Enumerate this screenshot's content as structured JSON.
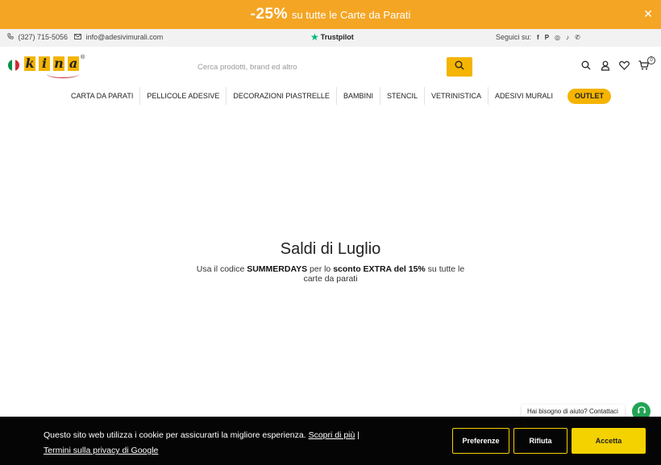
{
  "promo": {
    "percent": "-25%",
    "text": "su tutte le Carte da Parati",
    "close": "✕"
  },
  "infobar": {
    "phone": "(327) 715-5056",
    "email": "info@adesivimurali.com",
    "trustpilot": "Trustpilot",
    "follow_label": "Seguici su:",
    "social": [
      {
        "icon": "facebook-icon",
        "glyph": "f"
      },
      {
        "icon": "pinterest-icon",
        "glyph": "P"
      },
      {
        "icon": "instagram-icon",
        "glyph": "◎"
      },
      {
        "icon": "tiktok-icon",
        "glyph": "♪"
      },
      {
        "icon": "whatsapp-icon",
        "glyph": "✆"
      }
    ]
  },
  "header": {
    "logo_text": "kina",
    "logo_letters": [
      "k",
      "i",
      "n",
      "a"
    ],
    "reg": "®",
    "search_placeholder": "Cerca prodotti, brand ed altro",
    "cart_count": "0"
  },
  "nav": {
    "items": [
      "CARTA DA PARATI",
      "PELLICOLE ADESIVE",
      "DECORAZIONI PIASTRELLE",
      "BAMBINI",
      "STENCIL",
      "VETRINISTICA",
      "ADESIVI MURALI"
    ],
    "outlet": "OUTLET"
  },
  "hero": {
    "title": "Saldi di Luglio",
    "sub_pre": "Usa il codice ",
    "code": "SUMMERDAYS",
    "sub_mid": " per lo ",
    "offer": "sconto EXTRA del 15%",
    "sub_post": " su tutte le carte da parati"
  },
  "help": {
    "text": "Hai bisogno di aiuto? Contattaci"
  },
  "cookie": {
    "message": "Questo sito web utilizza i cookie per assicurarti la migliore esperienza.",
    "learn_more": "Scopri di più",
    "separator": "|",
    "privacy": "Termini sulla privacy di Google",
    "preferences": "Preferenze",
    "reject": "Rifiuta",
    "accept": "Accetta"
  },
  "colors": {
    "brand_yellow": "#f4b400",
    "promo_orange": "#f4a523",
    "trustpilot_green": "#00b67a",
    "help_green": "#23a455"
  }
}
